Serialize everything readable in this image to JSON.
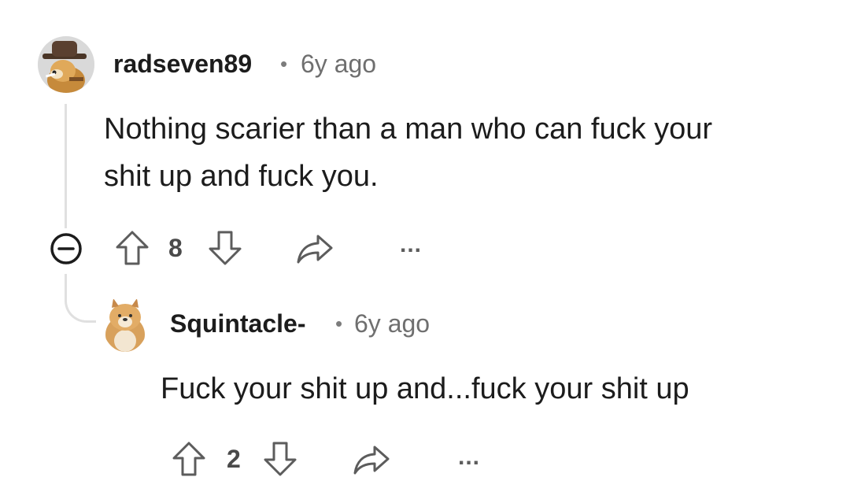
{
  "comments": [
    {
      "username": "radseven89",
      "separator": "•",
      "age": "6y ago",
      "body_lines": [
        "Nothing scarier than a man who can fuck your",
        "shit up and fuck you."
      ],
      "score": "8",
      "more": "..."
    },
    {
      "username": "Squintacle-",
      "separator": "•",
      "age": "6y ago",
      "body": "Fuck your shit up and...fuck your shit up",
      "score": "2",
      "more": "..."
    }
  ],
  "icons": {
    "collapse": "collapse-minus-icon",
    "upvote": "arrow-up-icon",
    "downvote": "arrow-down-icon",
    "share": "share-arrow-icon",
    "more": "more-dots-icon"
  },
  "colors": {
    "text": "#1c1c1c",
    "muted": "#6f6f6f",
    "icon": "#5c5c5c",
    "thread_line": "#e0e0e0"
  }
}
